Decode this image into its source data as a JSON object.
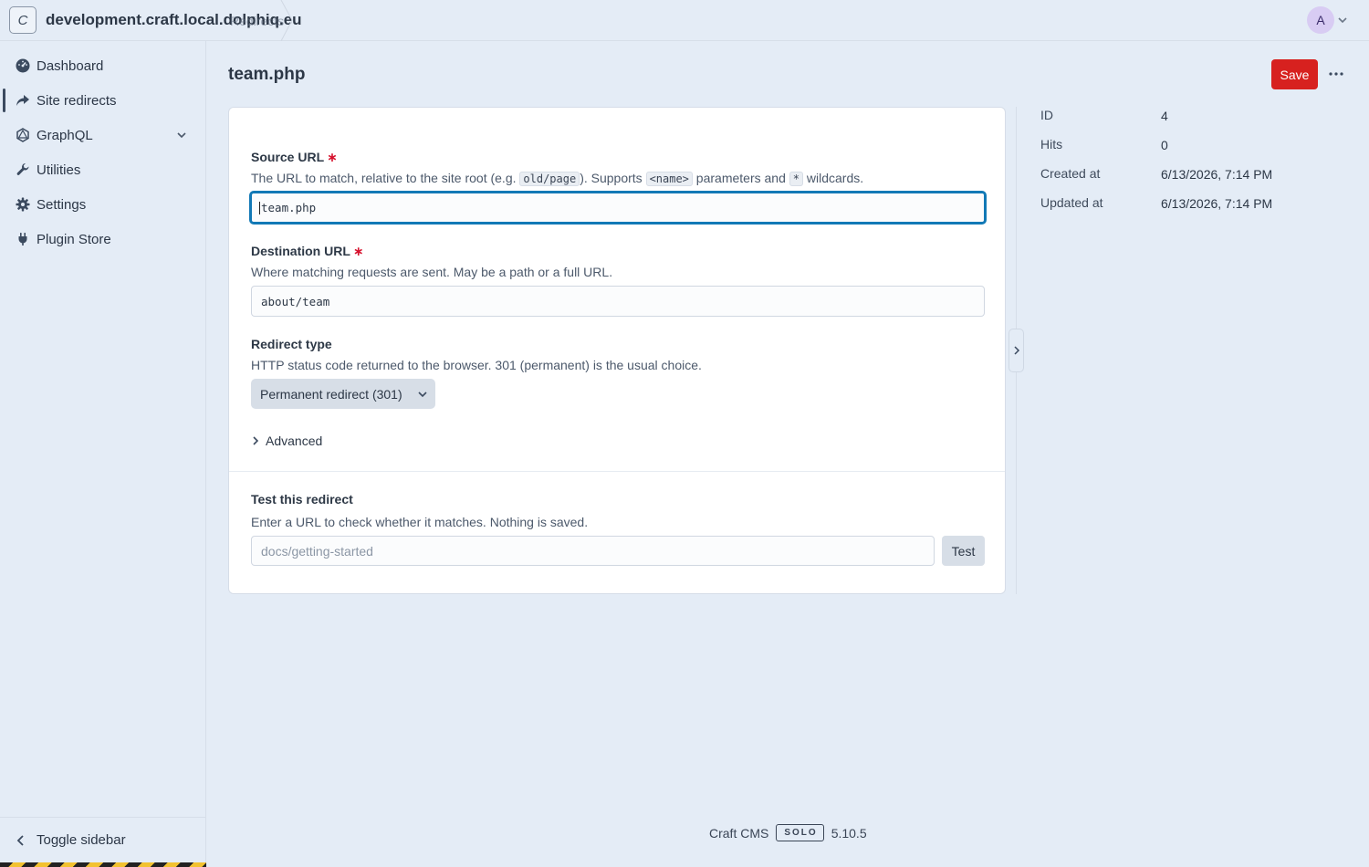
{
  "header": {
    "site_initial": "C",
    "site_name": "development.craft.local.dolphiq.eu",
    "breadcrumb_ghost": "Redirects",
    "user_initial": "A"
  },
  "sidebar": {
    "items": [
      {
        "label": "Dashboard",
        "icon": "dashboard-icon"
      },
      {
        "label": "Site redirects",
        "icon": "share-arrow-icon",
        "active": true
      },
      {
        "label": "GraphQL",
        "icon": "graphql-icon",
        "has_children": true
      },
      {
        "label": "Utilities",
        "icon": "wrench-icon"
      },
      {
        "label": "Settings",
        "icon": "gear-icon"
      },
      {
        "label": "Plugin Store",
        "icon": "plug-icon"
      }
    ],
    "toggle_label": "Toggle sidebar"
  },
  "page": {
    "title": "team.php",
    "save_label": "Save"
  },
  "form": {
    "source": {
      "label": "Source URL",
      "instr_pre": "The URL to match, relative to the site root (e.g. ",
      "code_example": "old/page",
      "instr_mid": "). Supports ",
      "code_param": "<name>",
      "instr_mid2": " parameters and ",
      "code_wild": "*",
      "instr_post": " wildcards.",
      "value": "team.php"
    },
    "destination": {
      "label": "Destination URL",
      "instr": "Where matching requests are sent. May be a path or a full URL.",
      "value": "about/team"
    },
    "redirect_type": {
      "label": "Redirect type",
      "instr": "HTTP status code returned to the browser. 301 (permanent) is the usual choice.",
      "selected": "Permanent redirect (301)"
    },
    "advanced_label": "Advanced",
    "test": {
      "label": "Test this redirect",
      "instr": "Enter a URL to check whether it matches. Nothing is saved.",
      "placeholder": "docs/getting-started",
      "button_label": "Test"
    }
  },
  "meta": {
    "id_label": "ID",
    "id_value": "4",
    "hits_label": "Hits",
    "hits_value": "0",
    "created_label": "Created at",
    "created_value": "6/13/2026, 7:14 PM",
    "updated_label": "Updated at",
    "updated_value": "6/13/2026, 7:14 PM"
  },
  "footer": {
    "product": "Craft CMS",
    "edition": "SOLO",
    "version": "5.10.5"
  },
  "colors": {
    "accent": "#d7211f",
    "focus": "#1279b6",
    "required": "#d6112d"
  }
}
